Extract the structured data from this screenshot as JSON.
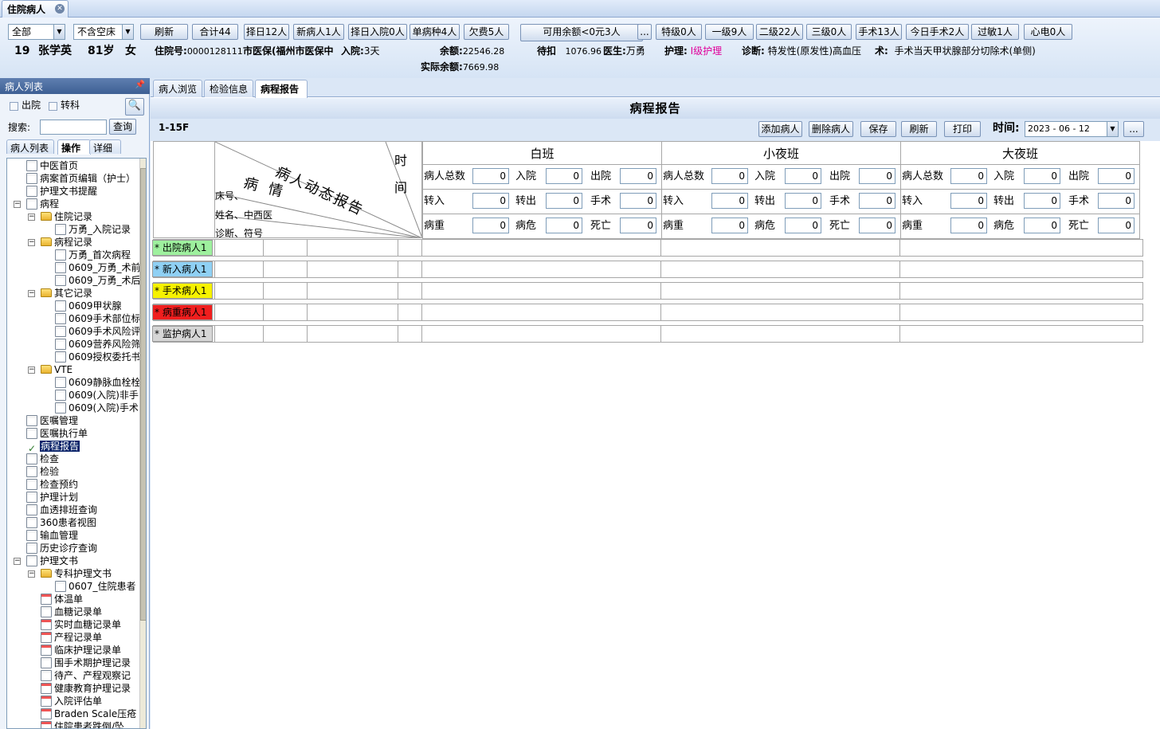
{
  "app": {
    "tab_title": "住院病人"
  },
  "toolbar": {
    "ward_filter": "全部",
    "bed_filter": "不含空床",
    "buttons": [
      "刷新",
      "合计44",
      "择日12人",
      "新病人1人",
      "择日入院0人",
      "单病种4人",
      "欠费5人"
    ],
    "available_balance_button": "可用余额<0元3人",
    "more_button": "...",
    "level_buttons": [
      "特级0人",
      "一级9人",
      "二级22人",
      "三级0人",
      "手术13人",
      "今日手术2人",
      "过敏1人",
      "心电0人"
    ]
  },
  "patient": {
    "bed": "19",
    "name": "张学英",
    "age": "81岁",
    "sex": "女",
    "inpatient_no_label": "住院号:",
    "inpatient_no": "0000128111",
    "insurance": "市医保(福州市医保中",
    "admit_label": "入院:",
    "admit_days": "3天",
    "balance_label": "余额:",
    "balance": "22546.28",
    "actual_balance_label": "实际余额:",
    "actual_balance": "7669.98",
    "pending_label": "待扣",
    "pending": "1076.96",
    "doctor_label": "医生:",
    "doctor": "万勇",
    "nursing_label": "护理:",
    "nursing": "I级护理",
    "diagnosis_label": "诊断:",
    "diagnosis": "特发性(原发性)高血压",
    "surgery_label": "术:",
    "surgery": "手术当天甲状腺部分切除术(单侧)"
  },
  "left_panel": {
    "header": "病人列表",
    "pin": "ᵖ",
    "discharged_label": "出院",
    "transfer_label": "转科",
    "search_label": "搜索:",
    "search_value": "",
    "query_button": "查询",
    "tabs": [
      "病人列表",
      "操作",
      "详细"
    ],
    "tree": [
      {
        "label": "中医首页",
        "lvl": 0,
        "icon": "doc"
      },
      {
        "label": "病案首页编辑（护士）",
        "lvl": 0,
        "icon": "doc"
      },
      {
        "label": "护理文书提醒",
        "lvl": 0,
        "icon": "doc"
      },
      {
        "label": "病程",
        "lvl": 0,
        "icon": "doc",
        "toggle": "−"
      },
      {
        "label": "住院记录",
        "lvl": 1,
        "icon": "folder",
        "toggle": "−"
      },
      {
        "label": "万勇_入院记录",
        "lvl": 2,
        "icon": "doc"
      },
      {
        "label": "病程记录",
        "lvl": 1,
        "icon": "folder",
        "toggle": "−"
      },
      {
        "label": "万勇_首次病程",
        "lvl": 2,
        "icon": "doc"
      },
      {
        "label": "0609_万勇_术前",
        "lvl": 2,
        "icon": "doc"
      },
      {
        "label": "0609_万勇_术后",
        "lvl": 2,
        "icon": "doc"
      },
      {
        "label": "其它记录",
        "lvl": 1,
        "icon": "folder",
        "toggle": "−"
      },
      {
        "label": "0609甲状腺",
        "lvl": 2,
        "icon": "doc"
      },
      {
        "label": "0609手术部位标",
        "lvl": 2,
        "icon": "doc"
      },
      {
        "label": "0609手术风险评",
        "lvl": 2,
        "icon": "doc"
      },
      {
        "label": "0609营养风险筛",
        "lvl": 2,
        "icon": "doc"
      },
      {
        "label": "0609授权委托书",
        "lvl": 2,
        "icon": "doc"
      },
      {
        "label": "VTE",
        "lvl": 1,
        "icon": "folder",
        "toggle": "−"
      },
      {
        "label": "0609静脉血栓栓",
        "lvl": 2,
        "icon": "doc"
      },
      {
        "label": "0609(入院)非手",
        "lvl": 2,
        "icon": "doc"
      },
      {
        "label": "0609(入院)手术",
        "lvl": 2,
        "icon": "doc"
      },
      {
        "label": "医嘱管理",
        "lvl": 0,
        "icon": "doc"
      },
      {
        "label": "医嘱执行单",
        "lvl": 0,
        "icon": "doc"
      },
      {
        "label": "病程报告",
        "lvl": 0,
        "icon": "check",
        "selected": true
      },
      {
        "label": "检查",
        "lvl": 0,
        "icon": "doc"
      },
      {
        "label": "检验",
        "lvl": 0,
        "icon": "doc"
      },
      {
        "label": "检查预约",
        "lvl": 0,
        "icon": "doc"
      },
      {
        "label": "护理计划",
        "lvl": 0,
        "icon": "doc"
      },
      {
        "label": "血透排班查询",
        "lvl": 0,
        "icon": "doc"
      },
      {
        "label": "360患者视图",
        "lvl": 0,
        "icon": "doc"
      },
      {
        "label": "输血管理",
        "lvl": 0,
        "icon": "doc"
      },
      {
        "label": "历史诊疗查询",
        "lvl": 0,
        "icon": "doc"
      },
      {
        "label": "护理文书",
        "lvl": 0,
        "icon": "doc",
        "toggle": "−"
      },
      {
        "label": "专科护理文书",
        "lvl": 1,
        "icon": "folder",
        "toggle": "−"
      },
      {
        "label": "0607_住院患者",
        "lvl": 2,
        "icon": "doc"
      },
      {
        "label": "体温单",
        "lvl": 1,
        "icon": "red"
      },
      {
        "label": "血糖记录单",
        "lvl": 1,
        "icon": "doc"
      },
      {
        "label": "实时血糖记录单",
        "lvl": 1,
        "icon": "red"
      },
      {
        "label": "产程记录单",
        "lvl": 1,
        "icon": "red"
      },
      {
        "label": "临床护理记录单",
        "lvl": 1,
        "icon": "red"
      },
      {
        "label": "围手术期护理记录",
        "lvl": 1,
        "icon": "doc"
      },
      {
        "label": "待产、产程观察记",
        "lvl": 1,
        "icon": "doc"
      },
      {
        "label": "健康教育护理记录",
        "lvl": 1,
        "icon": "red"
      },
      {
        "label": "入院评估单",
        "lvl": 1,
        "icon": "red"
      },
      {
        "label": "Braden Scale压疮",
        "lvl": 1,
        "icon": "red"
      },
      {
        "label": "住院患者跌倒/坠",
        "lvl": 1,
        "icon": "red"
      }
    ]
  },
  "main": {
    "tabs": [
      "病人浏览",
      "检验信息",
      "病程报告"
    ],
    "title": "病程报告",
    "ward": "1-15F",
    "buttons": [
      "添加病人",
      "删除病人",
      "保存",
      "刷新",
      "打印"
    ],
    "time_label": "时间:",
    "date_value": "2023 - 06 - 12",
    "more_button": "...",
    "header_diag": {
      "top": "病人动态报告",
      "mid": "病 情",
      "time": [
        "时",
        "间"
      ],
      "left": [
        "床号、",
        "姓名、中西医",
        "诊断、符号"
      ]
    },
    "shifts": [
      "白班",
      "小夜班",
      "大夜班"
    ],
    "stat_rows": [
      [
        {
          "label": "病人总数",
          "value": "0"
        },
        {
          "label": "入院",
          "value": "0"
        },
        {
          "label": "出院",
          "value": "0"
        }
      ],
      [
        {
          "label": "转入",
          "value": "0"
        },
        {
          "label": "转出",
          "value": "0"
        },
        {
          "label": "手术",
          "value": "0"
        }
      ],
      [
        {
          "label": "病重",
          "value": "0"
        },
        {
          "label": "病危",
          "value": "0"
        },
        {
          "label": "死亡",
          "value": "0"
        }
      ]
    ],
    "category_rows": [
      {
        "label": "* 出院病人1",
        "color": "#9ef09e"
      },
      {
        "label": "* 新入病人1",
        "color": "#8fd0f4"
      },
      {
        "label": "* 手术病人1",
        "color": "#f6f200"
      },
      {
        "label": "* 病重病人1",
        "color": "#f01e1e"
      },
      {
        "label": "* 监护病人1",
        "color": "#d6d6d6"
      }
    ]
  }
}
